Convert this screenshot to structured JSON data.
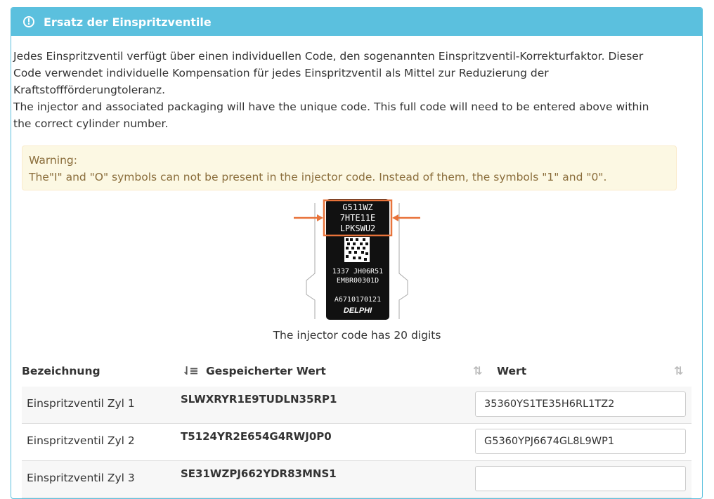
{
  "panel": {
    "title": "Ersatz der Einspritzventile",
    "description": [
      "Jedes Einspritzventil verfügt über einen individuellen Code, den sogenannten Einspritzventil-Korrekturfaktor. Dieser",
      "Code verwendet individuelle Kompensation für jedes Einspritzventil als Mittel zur Reduzierung der",
      "Kraftstoffförderungtoleranz.",
      "The injector and associated packaging will have the unique code. This full code will need to be entered above within",
      "the correct cylinder number."
    ],
    "warning": {
      "title": "Warning:",
      "text": "The\"I\" and \"O\" symbols can not be present in the injector code. Instead of them, the symbols \"1\" and \"0\"."
    }
  },
  "figure": {
    "code_lines": [
      "G511WZ",
      "7HTE11E",
      "LPKSWU2"
    ],
    "serial_lines": [
      "1337 JH06R51",
      "EMBR00301D"
    ],
    "part_number": "A6710170121",
    "brand": "DELPHI",
    "caption": "The injector code has 20 digits",
    "highlight_color": "#e8733a"
  },
  "table": {
    "headers": {
      "name": "Bezeichnung",
      "stored": "Gespeicherter Wert",
      "value": "Wert"
    },
    "rows": [
      {
        "name": "Einspritzventil Zyl 1",
        "stored": "SLWXRYR1E9TUDLN35RP1",
        "value": "35360YS1TE35H6RL1TZ2"
      },
      {
        "name": "Einspritzventil Zyl 2",
        "stored": "T5124YR2E654G4RWJ0P0",
        "value": "G5360YPJ6674GL8L9WP1"
      },
      {
        "name": "Einspritzventil Zyl 3",
        "stored": "SE31WZPJ662YDR83MNS1",
        "value": ""
      }
    ]
  },
  "colors": {
    "header_bg": "#5bc0de",
    "warning_bg": "#fcf8e3",
    "warning_text": "#8a6d3b"
  }
}
